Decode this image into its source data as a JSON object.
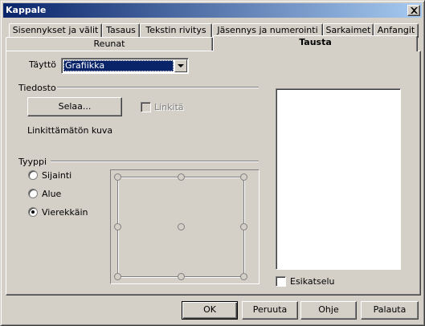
{
  "window": {
    "title": "Kappale"
  },
  "tabs": {
    "row1": [
      {
        "label": "Sisennykset ja välit"
      },
      {
        "label": "Tasaus"
      },
      {
        "label": "Tekstin rivitys"
      },
      {
        "label": "Jäsennys ja numerointi"
      },
      {
        "label": "Sarkaimet"
      },
      {
        "label": "Anfangit"
      }
    ],
    "row2": [
      {
        "label": "Reunat"
      },
      {
        "label": "Tausta",
        "active": true
      }
    ]
  },
  "fill": {
    "label": "Täyttö",
    "selected": "Grafiikka"
  },
  "file": {
    "section_label": "Tiedosto",
    "browse_label": "Selaa...",
    "link_label": "Linkitä",
    "link_checked": false,
    "link_disabled": true,
    "status": "Linkittämätön kuva"
  },
  "type": {
    "section_label": "Tyyppi",
    "options": [
      {
        "label": "Sijainti",
        "checked": false
      },
      {
        "label": "Alue",
        "checked": false
      },
      {
        "label": "Vierekkäin",
        "checked": true
      }
    ]
  },
  "preview": {
    "checkbox_label": "Esikatselu",
    "checked": false
  },
  "buttons": {
    "ok": "OK",
    "cancel": "Peruuta",
    "help": "Ohje",
    "reset": "Palauta"
  },
  "colors": {
    "titlebar_start": "#0a246a",
    "titlebar_end": "#a6caf0",
    "selection": "#0a246a"
  },
  "icons": [
    "close-icon",
    "chevron-down-icon",
    "position-grid"
  ]
}
